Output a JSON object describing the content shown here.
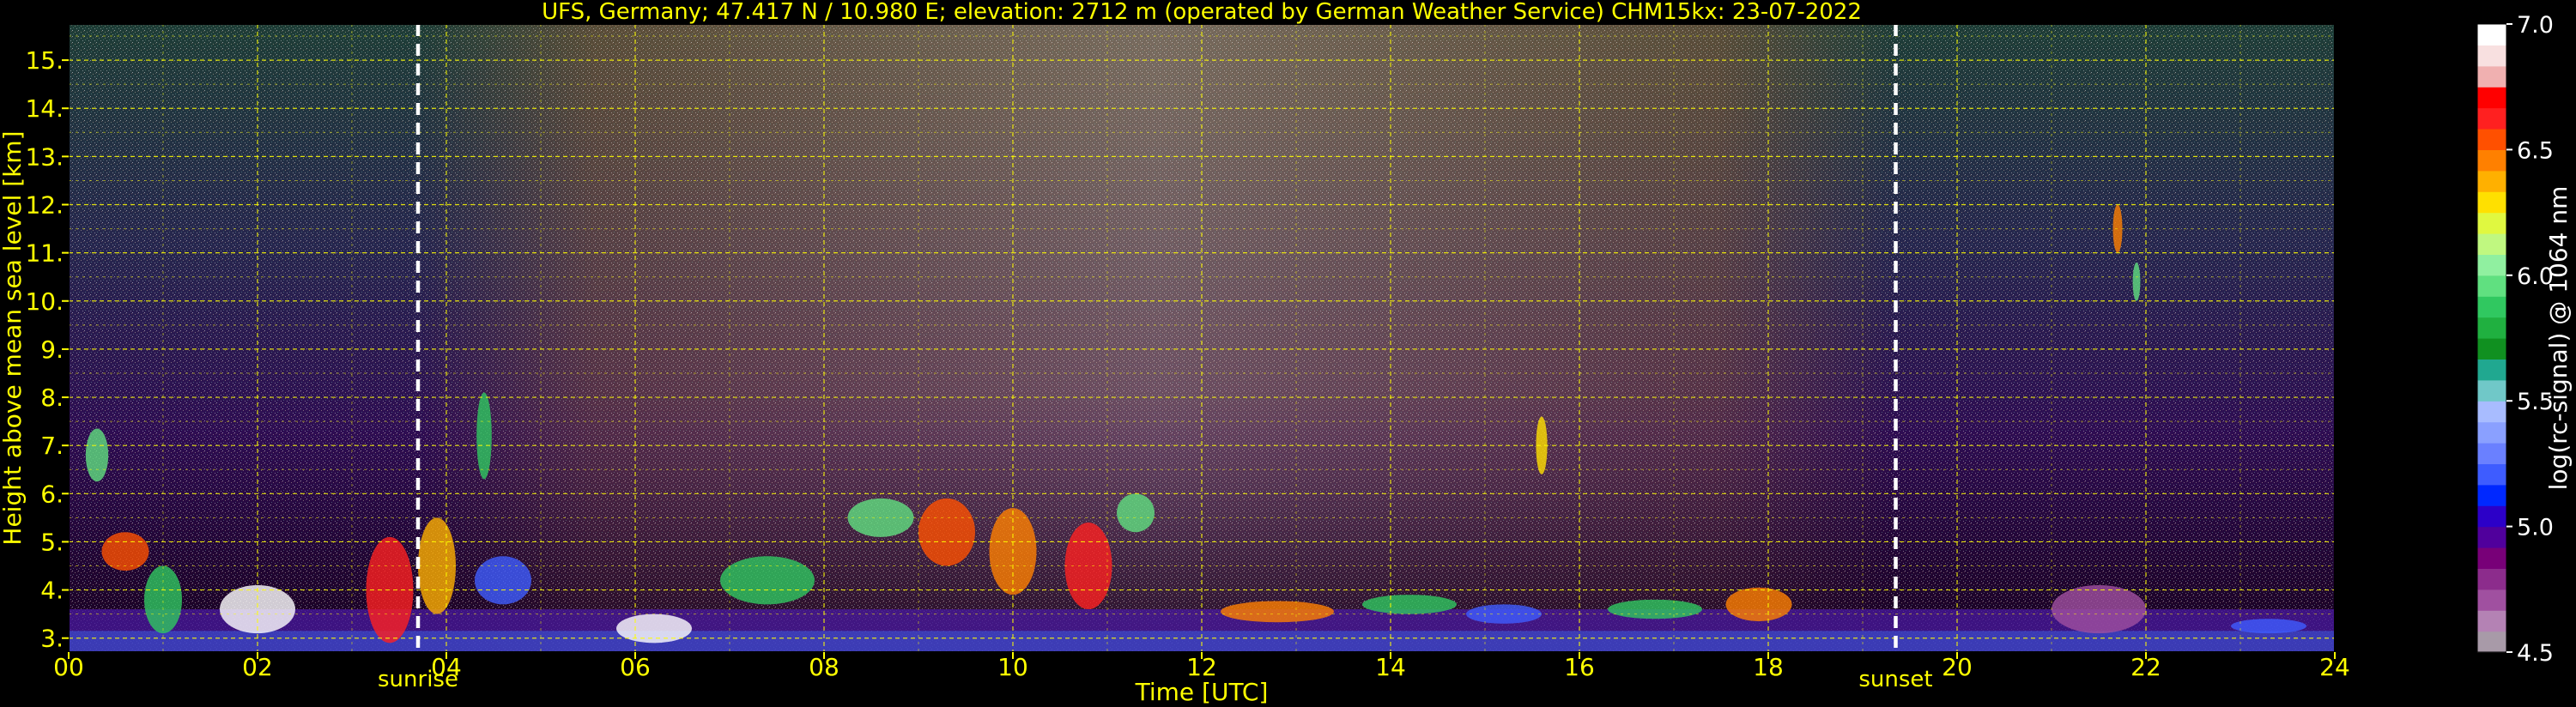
{
  "chart_data": {
    "type": "heatmap",
    "title": "UFS, Germany; 47.417 N / 10.980 E; elevation: 2712 m  (operated by German Weather Service)    CHM15kx: 23-07-2022",
    "xlabel": "Time [UTC]",
    "ylabel": "Height above mean sea level [km]",
    "xlim": [
      0,
      24
    ],
    "ylim": [
      2.71,
      15.75
    ],
    "x_ticks": [
      "00",
      "02",
      "04",
      "06",
      "08",
      "10",
      "12",
      "14",
      "16",
      "18",
      "20",
      "22",
      "24"
    ],
    "x_tick_values": [
      0,
      2,
      4,
      6,
      8,
      10,
      12,
      14,
      16,
      18,
      20,
      22,
      24
    ],
    "y_ticks": [
      "3.",
      "4.",
      "5.",
      "6.",
      "7.",
      "8.",
      "9.",
      "10.",
      "11.",
      "12.",
      "13.",
      "14.",
      "15."
    ],
    "y_tick_values": [
      3,
      4,
      5,
      6,
      7,
      8,
      9,
      10,
      11,
      12,
      13,
      14,
      15
    ],
    "grid": true,
    "grid_color": "#ffff00",
    "text_color": "#ffff00",
    "sun_events": [
      {
        "label": "sunrise",
        "time": 3.7
      },
      {
        "label": "sunset",
        "time": 19.35
      }
    ],
    "colorbar": {
      "label": "log(rc-signal) @ 1064 nm",
      "range": [
        4.5,
        7.0
      ],
      "tick_labels": [
        "4.5",
        "5.0",
        "5.5",
        "6.0",
        "6.5",
        "7.0"
      ],
      "tick_values": [
        4.5,
        5.0,
        5.5,
        6.0,
        6.5,
        7.0
      ],
      "colors": [
        "#a89aa8",
        "#b482b4",
        "#a050a0",
        "#8c2c8c",
        "#780078",
        "#50009c",
        "#2c00c8",
        "#0028ff",
        "#3e5cff",
        "#6a80ff",
        "#8aa0ff",
        "#a8bcff",
        "#70c8c8",
        "#20a890",
        "#109020",
        "#20b040",
        "#30c860",
        "#60e080",
        "#90f0a0",
        "#c0f880",
        "#e0f840",
        "#ffe000",
        "#ffb000",
        "#ff8000",
        "#ff5000",
        "#ff2020",
        "#ff0000",
        "#f0b0b0",
        "#f8e0e0",
        "#ffffff"
      ]
    }
  }
}
